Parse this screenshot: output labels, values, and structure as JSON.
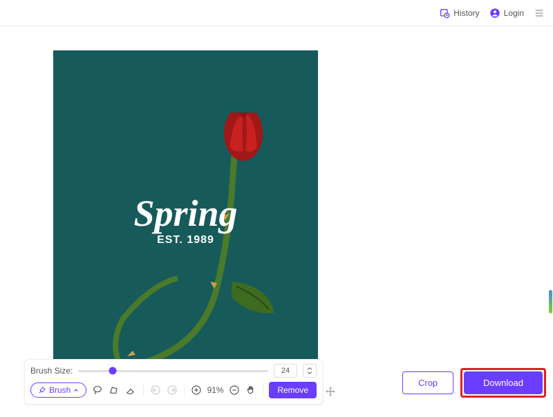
{
  "topbar": {
    "history": "History",
    "login": "Login"
  },
  "canvas": {
    "title": "Spring",
    "subtitle": "EST. 1989"
  },
  "toolbar": {
    "brush_size_label": "Brush Size:",
    "brush_size_value": "24",
    "brush_label": "Brush",
    "zoom": "91%",
    "remove": "Remove"
  },
  "actions": {
    "crop": "Crop",
    "download": "Download"
  }
}
